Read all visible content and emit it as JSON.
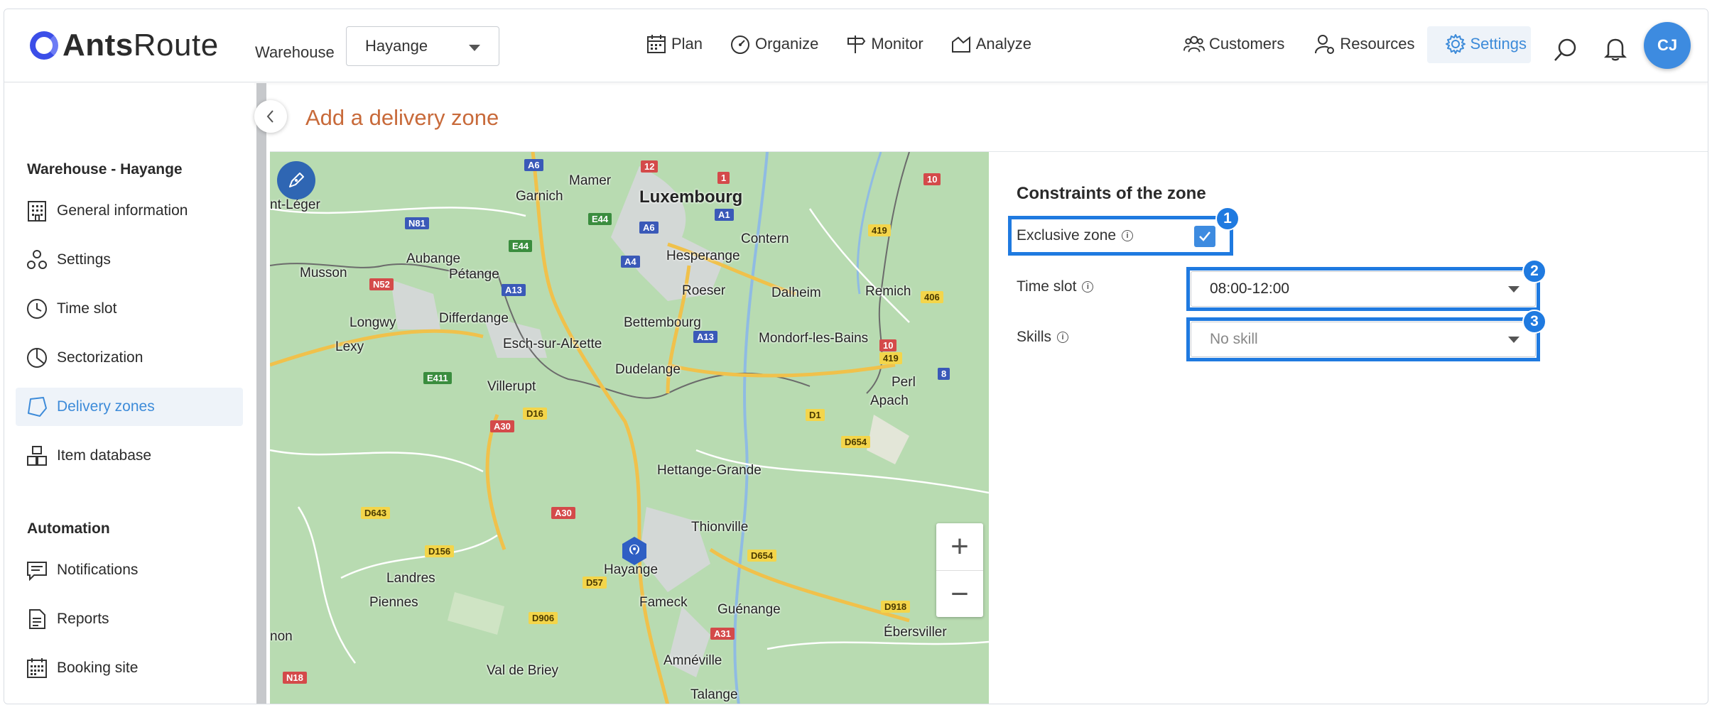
{
  "app": {
    "logo_text_bold": "Ants",
    "logo_text_light": "Route",
    "warehouse_label": "Warehouse",
    "warehouse_value": "Hayange",
    "avatar_initials": "CJ",
    "accent_color": "#3d8bd9"
  },
  "nav": {
    "main": [
      {
        "label": "Plan",
        "icon": "calendar-icon"
      },
      {
        "label": "Organize",
        "icon": "gauge-icon"
      },
      {
        "label": "Monitor",
        "icon": "signpost-icon"
      },
      {
        "label": "Analyze",
        "icon": "chart-icon"
      }
    ],
    "right": [
      {
        "label": "Customers",
        "icon": "customers-icon"
      },
      {
        "label": "Resources",
        "icon": "resources-icon"
      },
      {
        "label": "Settings",
        "icon": "gear-icon",
        "active": true
      }
    ]
  },
  "sidebar": {
    "section1": "Warehouse - Hayange",
    "items1": [
      {
        "label": "General information",
        "icon": "building-icon"
      },
      {
        "label": "Settings",
        "icon": "settings-icon"
      },
      {
        "label": "Time slot",
        "icon": "clock-icon"
      },
      {
        "label": "Sectorization",
        "icon": "pie-icon"
      },
      {
        "label": "Delivery zones",
        "icon": "zone-icon",
        "active": true
      },
      {
        "label": "Item database",
        "icon": "boxes-icon"
      }
    ],
    "section2": "Automation",
    "items2": [
      {
        "label": "Notifications",
        "icon": "message-icon"
      },
      {
        "label": "Reports",
        "icon": "document-icon"
      },
      {
        "label": "Booking site",
        "icon": "calendar-grid-icon"
      }
    ]
  },
  "page": {
    "title": "Add a delivery zone"
  },
  "map": {
    "places": [
      "Mamer",
      "Garnich",
      "Luxembourg",
      "nt-Léger",
      "Contern",
      "Hesperange",
      "Musson",
      "Aubange",
      "Pétange",
      "Roeser",
      "Dalheim",
      "Remich",
      "Longwy",
      "Differdange",
      "Bettembourg",
      "Mondorf-les-Bains",
      "Lexy",
      "Esch-sur-Alzette",
      "Dudelange",
      "Perl",
      "Apach",
      "Villerupt",
      "Hettange-Grande",
      "Thionville",
      "Hayange",
      "Landres",
      "Fameck",
      "Guénange",
      "Piennes",
      "Ébersviller",
      "non",
      "Val de Briey",
      "Amnéville",
      "Talange"
    ],
    "roads": [
      "A6",
      "12",
      "1",
      "10",
      "N81",
      "E44",
      "A6",
      "A1",
      "419",
      "E44",
      "A4",
      "N52",
      "A13",
      "406",
      "A13",
      "10",
      "419",
      "8",
      "E411",
      "D16",
      "D1",
      "A30",
      "D654",
      "A30",
      "D643",
      "D156",
      "D654",
      "D57",
      "D906",
      "D918",
      "A31",
      "N18"
    ],
    "zoom_in": "+",
    "zoom_out": "−"
  },
  "constraints": {
    "title": "Constraints of the zone",
    "exclusive_label": "Exclusive zone",
    "exclusive_checked": true,
    "timeslot_label": "Time slot",
    "timeslot_value": "08:00-12:00",
    "skills_label": "Skills",
    "skills_value": "No skill",
    "info_glyph": "i",
    "badges": [
      "1",
      "2",
      "3"
    ]
  }
}
